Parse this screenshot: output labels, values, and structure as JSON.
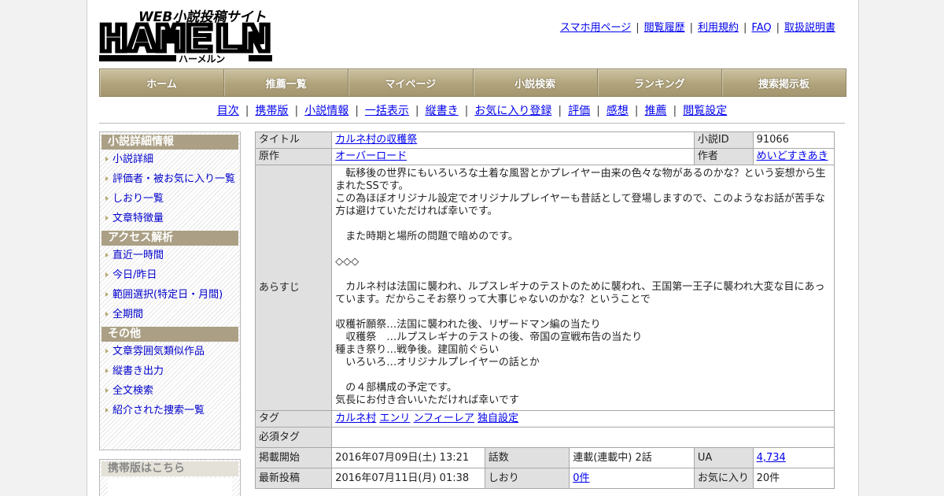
{
  "logo": {
    "top_text": "WEB小説投稿サイト",
    "main_text": "HAMELN",
    "kana": "ハーメルン"
  },
  "top_links": [
    "スマホ用ページ",
    "閲覧履歴",
    "利用規約",
    "FAQ",
    "取扱説明書"
  ],
  "global_nav": [
    "ホーム",
    "推薦一覧",
    "マイページ",
    "小説検索",
    "ランキング",
    "捜索掲示板"
  ],
  "sub_nav": [
    "目次",
    "携帯版",
    "小説情報",
    "一括表示",
    "縦書き",
    "お気に入り登録",
    "評価",
    "感想",
    "推薦",
    "閲覧設定"
  ],
  "side_menu": [
    {
      "heading": "小説詳細情報",
      "items": [
        "小説詳細",
        "評価者・被お気に入り一覧",
        "しおり一覧",
        "文章特徴量"
      ]
    },
    {
      "heading": "アクセス解析",
      "items": [
        "直近一時間",
        "今日/昨日",
        "範囲選択(特定日・月間)",
        "全期間"
      ]
    },
    {
      "heading": "その他",
      "items": [
        "文章雰囲気類似作品",
        "縦書き出力",
        "全文検索",
        "紹介された捜索一覧"
      ]
    }
  ],
  "mobile_box": {
    "heading": "携帯版はこちら"
  },
  "details": {
    "title_label": "タイトル",
    "title": "カルネ村の収穫祭",
    "id_label": "小説ID",
    "id": "91066",
    "original_label": "原作",
    "original": "オーバーロード",
    "author_label": "作者",
    "author": "めいどすきあき",
    "summary_label": "あらすじ",
    "summary_lines": [
      "　転移後の世界にもいろいろな土着な風習とかプレイヤー由来の色々な物があるのかな？という妄想から生まれたSSです。",
      "この為ほぼオリジナル設定でオリジナルプレイヤーも昔話として登場しますので、このようなお話が苦手な方は避けていただければ幸いです。",
      "",
      "　また時期と場所の問題で暗めのです。",
      "",
      "◇◇◇",
      "",
      "　カルネ村は法国に襲われ、ルプスレギナのテストのために襲われ、王国第一王子に襲われ大変な目にあっています。だからこそお祭りって大事じゃないのかな？ということで",
      "",
      "収穫祈願祭…法国に襲われた後、リザードマン編の当たり",
      "　収穫祭　…ルプスレギナのテストの後、帝国の宣戦布告の当たり",
      "種まき祭り…戦争後。建国前ぐらい",
      "　いろいろ…オリジナルプレイヤーの話とか",
      "",
      "　の４部構成の予定です。",
      "気長にお付き合いいただければ幸いです"
    ],
    "tags_label": "タグ",
    "tags": [
      "カルネ村",
      "エンリ",
      "ンフィーレア",
      "独自設定"
    ],
    "required_tags_label": "必須タグ",
    "published_label": "掲載開始",
    "published": "2016年07月09日(土) 13:21",
    "episodes_label": "話数",
    "episodes": "連載(連載中) 2話",
    "ua_label": "UA",
    "ua": "4,734",
    "updated_label": "最新投稿",
    "updated": "2016年07月11日(月) 01:38",
    "bookmarks_label": "しおり",
    "bookmarks": "0件",
    "favorites_label": "お気に入り",
    "favorites": "20件"
  }
}
